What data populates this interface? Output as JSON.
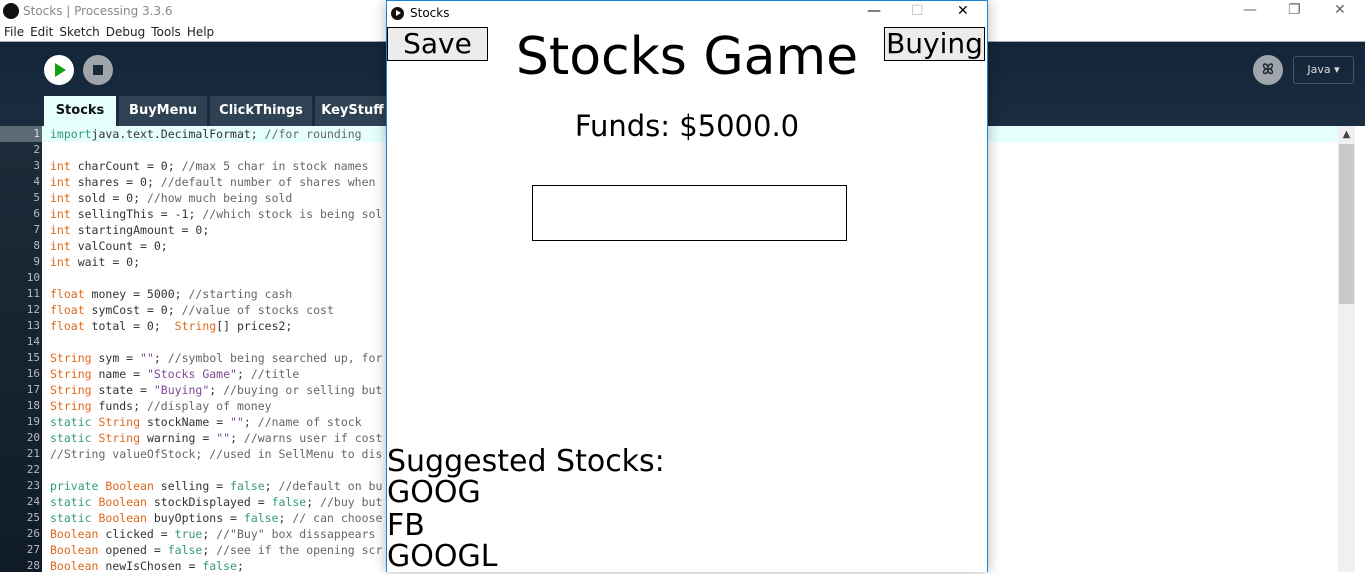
{
  "ide": {
    "title": "Stocks | Processing 3.3.6",
    "logo": "P3",
    "menu": [
      "File",
      "Edit",
      "Sketch",
      "Debug",
      "Tools",
      "Help"
    ],
    "mode": "Java ▾",
    "tabs": [
      "Stocks",
      "BuyMenu",
      "ClickThings",
      "KeyStuff"
    ],
    "window_controls": {
      "minimize": "—",
      "restore": "❐",
      "close": "✕"
    }
  },
  "code": [
    [
      [
        "g",
        "import"
      ],
      [
        "",
        "java.text.DecimalFormat; "
      ],
      [
        "c",
        "//for rounding"
      ]
    ],
    [],
    [
      [
        "k",
        "int"
      ],
      [
        "",
        " charCount = 0; "
      ],
      [
        "c",
        "//max 5 char in stock names"
      ]
    ],
    [
      [
        "k",
        "int"
      ],
      [
        "",
        " shares = 0; "
      ],
      [
        "c",
        "//default number of shares when"
      ]
    ],
    [
      [
        "k",
        "int"
      ],
      [
        "",
        " sold = 0; "
      ],
      [
        "c",
        "//how much being sold"
      ]
    ],
    [
      [
        "k",
        "int"
      ],
      [
        "",
        " sellingThis = -1; "
      ],
      [
        "c",
        "//which stock is being sol"
      ]
    ],
    [
      [
        "k",
        "int"
      ],
      [
        "",
        " startingAmount = 0;"
      ]
    ],
    [
      [
        "k",
        "int"
      ],
      [
        "",
        " valCount = 0;"
      ]
    ],
    [
      [
        "k",
        "int"
      ],
      [
        "",
        " wait = 0;"
      ]
    ],
    [],
    [
      [
        "k",
        "float"
      ],
      [
        "",
        " money = 5000; "
      ],
      [
        "c",
        "//starting cash"
      ]
    ],
    [
      [
        "k",
        "float"
      ],
      [
        "",
        " symCost = 0; "
      ],
      [
        "c",
        "//value of stocks cost"
      ]
    ],
    [
      [
        "k",
        "float"
      ],
      [
        "",
        " total = 0;  "
      ],
      [
        "k",
        "String"
      ],
      [
        "",
        "[] prices2;"
      ]
    ],
    [],
    [
      [
        "k",
        "String"
      ],
      [
        "",
        " sym = "
      ],
      [
        "s",
        "\"\""
      ],
      [
        "",
        "; "
      ],
      [
        "c",
        "//symbol being searched up, for"
      ]
    ],
    [
      [
        "k",
        "String"
      ],
      [
        "",
        " name = "
      ],
      [
        "s",
        "\"Stocks Game\""
      ],
      [
        "",
        "; "
      ],
      [
        "c",
        "//title"
      ]
    ],
    [
      [
        "k",
        "String"
      ],
      [
        "",
        " state = "
      ],
      [
        "s",
        "\"Buying\""
      ],
      [
        "",
        "; "
      ],
      [
        "c",
        "//buying or selling but"
      ]
    ],
    [
      [
        "k",
        "String"
      ],
      [
        "",
        " funds; "
      ],
      [
        "c",
        "//display of money"
      ]
    ],
    [
      [
        "g",
        "static"
      ],
      [
        "",
        " "
      ],
      [
        "k",
        "String"
      ],
      [
        "",
        " stockName = "
      ],
      [
        "s",
        "\"\""
      ],
      [
        "",
        "; "
      ],
      [
        "c",
        "//name of stock"
      ]
    ],
    [
      [
        "g",
        "static"
      ],
      [
        "",
        " "
      ],
      [
        "k",
        "String"
      ],
      [
        "",
        " warning = "
      ],
      [
        "s",
        "\"\""
      ],
      [
        "",
        "; "
      ],
      [
        "c",
        "//warns user if cost"
      ]
    ],
    [
      [
        "c",
        "//String valueOfStock; //used in SellMenu to dis"
      ]
    ],
    [],
    [
      [
        "g",
        "private"
      ],
      [
        "",
        " "
      ],
      [
        "k",
        "Boolean"
      ],
      [
        "",
        " selling = "
      ],
      [
        "g",
        "false"
      ],
      [
        "",
        "; "
      ],
      [
        "c",
        "//default on bu"
      ]
    ],
    [
      [
        "g",
        "static"
      ],
      [
        "",
        " "
      ],
      [
        "k",
        "Boolean"
      ],
      [
        "",
        " stockDisplayed = "
      ],
      [
        "g",
        "false"
      ],
      [
        "",
        "; "
      ],
      [
        "c",
        "//buy but"
      ]
    ],
    [
      [
        "g",
        "static"
      ],
      [
        "",
        " "
      ],
      [
        "k",
        "Boolean"
      ],
      [
        "",
        " buyOptions = "
      ],
      [
        "g",
        "false"
      ],
      [
        "",
        "; "
      ],
      [
        "c",
        "// can choose"
      ]
    ],
    [
      [
        "k",
        "Boolean"
      ],
      [
        "",
        " clicked = "
      ],
      [
        "g",
        "true"
      ],
      [
        "",
        "; "
      ],
      [
        "c",
        "//\"Buy\" box dissappears"
      ]
    ],
    [
      [
        "k",
        "Boolean"
      ],
      [
        "",
        " opened = "
      ],
      [
        "g",
        "false"
      ],
      [
        "",
        "; "
      ],
      [
        "c",
        "//see if the opening scr"
      ]
    ],
    [
      [
        "k",
        "Boolean"
      ],
      [
        "",
        " newIsChosen = "
      ],
      [
        "g",
        "false"
      ],
      [
        "",
        ";"
      ]
    ]
  ],
  "sketch": {
    "window_title": "Stocks",
    "save_label": "Save",
    "state_label": "Buying",
    "title": "Stocks Game",
    "funds": "Funds: $5000.0",
    "suggested_heading": "Suggested Stocks:",
    "suggested": [
      "GOOG",
      "FB",
      "GOOGL"
    ],
    "window_controls": {
      "minimize": "—",
      "maximize": "☐",
      "close": "✕"
    }
  }
}
